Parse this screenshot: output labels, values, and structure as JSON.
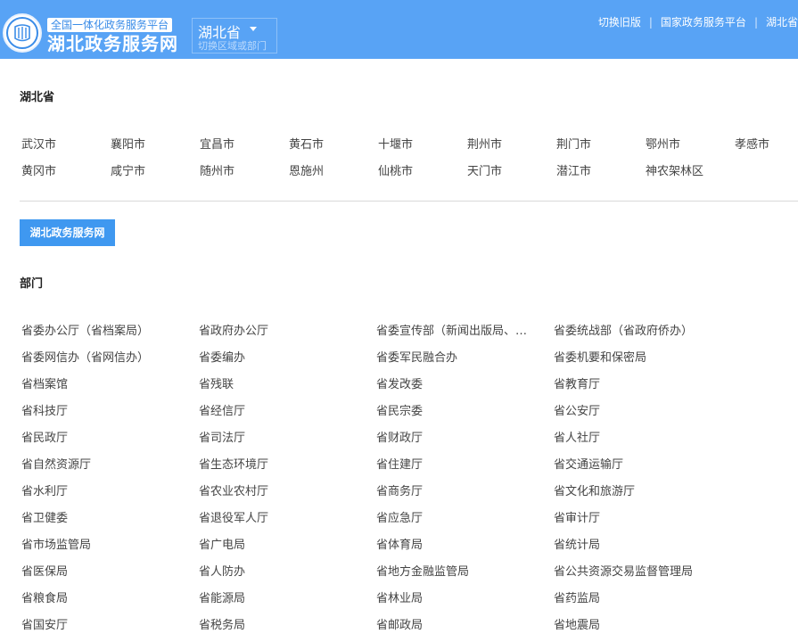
{
  "header": {
    "tagline": "全国一体化政务服务平台",
    "site_title": "湖北政务服务网",
    "region": {
      "name": "湖北省",
      "hint": "切换区域或部门"
    },
    "links": [
      "切换旧版",
      "国家政务服务平台",
      "湖北省"
    ]
  },
  "province": {
    "title": "湖北省",
    "cities": [
      "武汉市",
      "襄阳市",
      "宜昌市",
      "黄石市",
      "十堰市",
      "荆州市",
      "荆门市",
      "鄂州市",
      "孝感市",
      "黄冈市",
      "咸宁市",
      "随州市",
      "恩施州",
      "仙桃市",
      "天门市",
      "潜江市",
      "神农架林区"
    ]
  },
  "portal_button": "湖北政务服务网",
  "departments": {
    "title": "部门",
    "items": [
      "省委办公厅（省档案局）",
      "省政府办公厅",
      "省委宣传部（新闻出版局、…",
      "省委统战部（省政府侨办）",
      "省委网信办（省网信办）",
      "省委编办",
      "省委军民融合办",
      "省委机要和保密局",
      "省档案馆",
      "省残联",
      "省发改委",
      "省教育厅",
      "省科技厅",
      "省经信厅",
      "省民宗委",
      "省公安厅",
      "省民政厅",
      "省司法厅",
      "省财政厅",
      "省人社厅",
      "省自然资源厅",
      "省生态环境厅",
      "省住建厅",
      "省交通运输厅",
      "省水利厅",
      "省农业农村厅",
      "省商务厅",
      "省文化和旅游厅",
      "省卫健委",
      "省退役军人厅",
      "省应急厅",
      "省审计厅",
      "省市场监管局",
      "省广电局",
      "省体育局",
      "省统计局",
      "省医保局",
      "省人防办",
      "省地方金融监管局",
      "省公共资源交易监督管理局",
      "省粮食局",
      "省能源局",
      "省林业局",
      "省药监局",
      "省国安厅",
      "省税务局",
      "省邮政局",
      "省地震局"
    ]
  }
}
